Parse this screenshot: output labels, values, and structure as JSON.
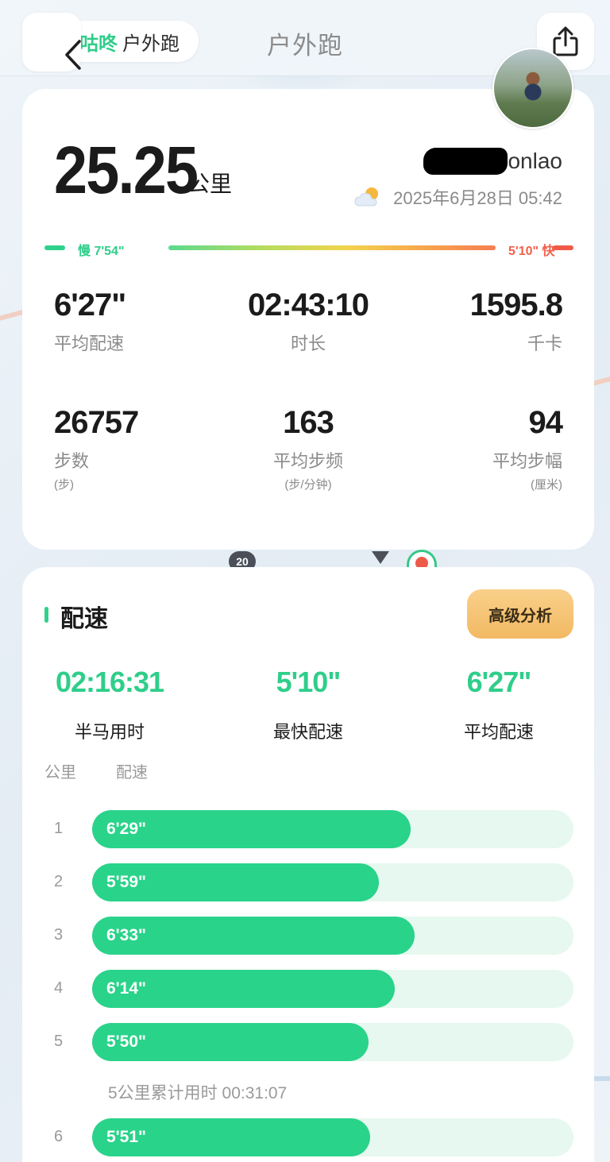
{
  "header": {
    "brand": "咕咚",
    "section": "户外跑",
    "title": "户外跑"
  },
  "summary": {
    "distance": "25.25",
    "distance_unit": "公里",
    "username_suffix": "onlao",
    "datetime": "2025年6月28日 05:42",
    "pace_range": {
      "slow": "慢 7'54\"",
      "fast": "5'10\" 快"
    },
    "stats": [
      {
        "value": "6'27\"",
        "label": "平均配速",
        "sub": ""
      },
      {
        "value": "02:43:10",
        "label": "时长",
        "sub": ""
      },
      {
        "value": "1595.8",
        "label": "千卡",
        "sub": ""
      },
      {
        "value": "26757",
        "label": "步数",
        "sub": "(步)"
      },
      {
        "value": "163",
        "label": "平均步频",
        "sub": "(步/分钟)"
      },
      {
        "value": "94",
        "label": "平均步幅",
        "sub": "(厘米)"
      }
    ]
  },
  "map": {
    "badge": "20"
  },
  "pace": {
    "title": "配速",
    "advanced_button": "高级分析",
    "stats": [
      {
        "value": "02:16:31",
        "label": "半马用时"
      },
      {
        "value": "5'10\"",
        "label": "最快配速"
      },
      {
        "value": "6'27\"",
        "label": "平均配速"
      }
    ],
    "col_km": "公里",
    "col_pace": "配速",
    "splits": [
      {
        "km": "1",
        "pace": "6'29\"",
        "fill": 0.662
      },
      {
        "km": "2",
        "pace": "5'59\"",
        "fill": 0.595
      },
      {
        "km": "3",
        "pace": "6'33\"",
        "fill": 0.67
      },
      {
        "km": "4",
        "pace": "6'14\"",
        "fill": 0.628
      },
      {
        "km": "5",
        "pace": "5'50\"",
        "fill": 0.574
      },
      {
        "km": "6",
        "pace": "5'51\"",
        "fill": 0.578
      }
    ],
    "cumulative_note": "5公里累计用时 00:31:07"
  },
  "colors": {
    "accent": "#2fd18b",
    "fast": "#f05a47",
    "track": "#e6f8ef",
    "button": "#f2b962"
  }
}
